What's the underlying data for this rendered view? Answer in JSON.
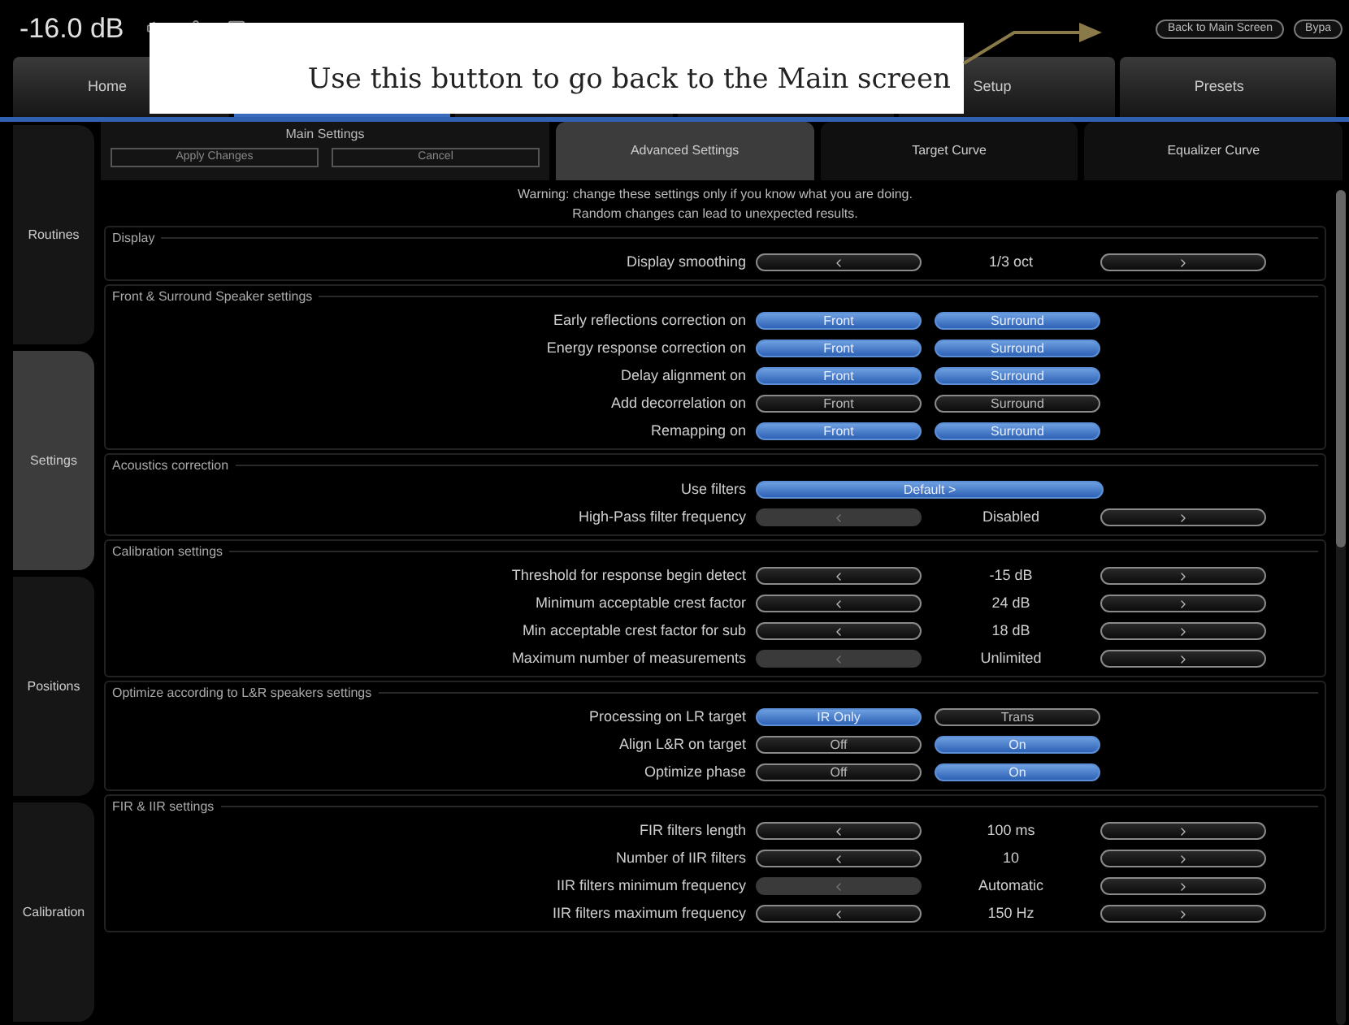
{
  "top_bar": {
    "level": "-16.0 dB",
    "buttons": [
      {
        "label": "Back to Main Screen"
      },
      {
        "label": "Bypa"
      }
    ]
  },
  "callout": {
    "text": "Use this button to go back to the Main screen"
  },
  "main_tabs": [
    {
      "label": "Home",
      "selected": false
    },
    {
      "selected": true
    },
    {
      "selected": false
    },
    {
      "selected": false
    },
    {
      "label": "Setup",
      "selected": false
    },
    {
      "label": "Presets",
      "selected": false
    }
  ],
  "side_tabs": [
    {
      "label": "Routines",
      "selected": false
    },
    {
      "label": "Settings",
      "selected": true
    },
    {
      "label": "Positions",
      "selected": false
    },
    {
      "label": "Calibration",
      "selected": false
    }
  ],
  "main_settings": {
    "title": "Main Settings",
    "buttons": [
      "Apply Changes",
      "Cancel"
    ]
  },
  "sub_tabs": [
    {
      "label": "Advanced Settings",
      "selected": true
    },
    {
      "label": "Target Curve",
      "selected": false
    },
    {
      "label": "Equalizer Curve",
      "selected": false
    }
  ],
  "warning": [
    "Warning: change these settings only if you know what you are doing.",
    "Random changes can lead to unexpected results."
  ],
  "sections": [
    {
      "title": "Display",
      "rows": [
        {
          "kind": "stepper",
          "label": "Display smoothing",
          "value": "1/3 oct",
          "prev_disabled": false
        }
      ]
    },
    {
      "title": "Front & Surround Speaker settings",
      "rows": [
        {
          "kind": "toggles",
          "label": "Early reflections correction on",
          "options": [
            {
              "label": "Front",
              "on": true
            },
            {
              "label": "Surround",
              "on": true
            }
          ]
        },
        {
          "kind": "toggles",
          "label": "Energy response correction on",
          "options": [
            {
              "label": "Front",
              "on": true
            },
            {
              "label": "Surround",
              "on": true
            }
          ]
        },
        {
          "kind": "toggles",
          "label": "Delay alignment on",
          "options": [
            {
              "label": "Front",
              "on": true
            },
            {
              "label": "Surround",
              "on": true
            }
          ]
        },
        {
          "kind": "toggles",
          "label": "Add decorrelation on",
          "options": [
            {
              "label": "Front",
              "on": false
            },
            {
              "label": "Surround",
              "on": false
            }
          ]
        },
        {
          "kind": "toggles",
          "label": "Remapping on",
          "options": [
            {
              "label": "Front",
              "on": true
            },
            {
              "label": "Surround",
              "on": true
            }
          ]
        }
      ]
    },
    {
      "title": "Acoustics correction",
      "rows": [
        {
          "kind": "select",
          "label": "Use filters",
          "value": "Default >"
        },
        {
          "kind": "stepper",
          "label": "High-Pass filter frequency",
          "value": "Disabled",
          "prev_disabled": true
        }
      ]
    },
    {
      "title": "Calibration settings",
      "rows": [
        {
          "kind": "stepper",
          "label": "Threshold for response begin detect",
          "value": "-15 dB",
          "prev_disabled": false
        },
        {
          "kind": "stepper",
          "label": "Minimum acceptable crest factor",
          "value": "24 dB",
          "prev_disabled": false
        },
        {
          "kind": "stepper",
          "label": "Min acceptable crest factor for sub",
          "value": "18 dB",
          "prev_disabled": false
        },
        {
          "kind": "stepper",
          "label": "Maximum number of measurements",
          "value": "Unlimited",
          "prev_disabled": true
        }
      ]
    },
    {
      "title": "Optimize according to L&R speakers settings",
      "rows": [
        {
          "kind": "toggles",
          "label": "Processing on LR target",
          "options": [
            {
              "label": "IR Only",
              "on": true
            },
            {
              "label": "Trans",
              "on": false
            }
          ]
        },
        {
          "kind": "toggles",
          "label": "Align L&R on target",
          "options": [
            {
              "label": "Off",
              "on": false
            },
            {
              "label": "On",
              "on": true
            }
          ]
        },
        {
          "kind": "toggles",
          "label": "Optimize phase",
          "options": [
            {
              "label": "Off",
              "on": false
            },
            {
              "label": "On",
              "on": true
            }
          ]
        }
      ]
    },
    {
      "title": "FIR & IIR settings",
      "rows": [
        {
          "kind": "stepper",
          "label": "FIR filters length",
          "value": "100 ms",
          "prev_disabled": false
        },
        {
          "kind": "stepper",
          "label": "Number of IIR filters",
          "value": "10",
          "prev_disabled": false
        },
        {
          "kind": "stepper",
          "label": "IIR filters minimum frequency",
          "value": "Automatic",
          "prev_disabled": true
        },
        {
          "kind": "stepper",
          "label": "IIR filters maximum frequency",
          "value": "150 Hz",
          "prev_disabled": false
        }
      ]
    }
  ]
}
